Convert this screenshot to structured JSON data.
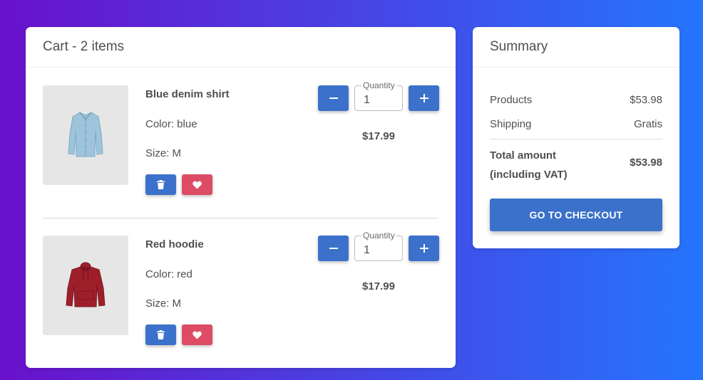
{
  "cart": {
    "title": "Cart - 2 items",
    "quantity_label": "Quantity",
    "items": [
      {
        "name": "Blue denim shirt",
        "color": "Color: blue",
        "size": "Size: M",
        "quantity": "1",
        "price": "$17.99",
        "product_icon": "shirt-icon",
        "product_color": "#9ec4dc"
      },
      {
        "name": "Red hoodie",
        "color": "Color: red",
        "size": "Size: M",
        "quantity": "1",
        "price": "$17.99",
        "product_icon": "hoodie-icon",
        "product_color": "#9e1f2a"
      }
    ]
  },
  "summary": {
    "title": "Summary",
    "products_label": "Products",
    "products_value": "$53.98",
    "shipping_label": "Shipping",
    "shipping_value": "Gratis",
    "total_label_line1": "Total amount",
    "total_label_line2": "(including VAT)",
    "total_value": "$53.98",
    "checkout_label": "GO TO CHECKOUT"
  },
  "theme": {
    "gradient_start": "#6a11cb",
    "gradient_end": "#2575fc",
    "primary": "#3b71ca",
    "danger": "#dc4c64"
  }
}
